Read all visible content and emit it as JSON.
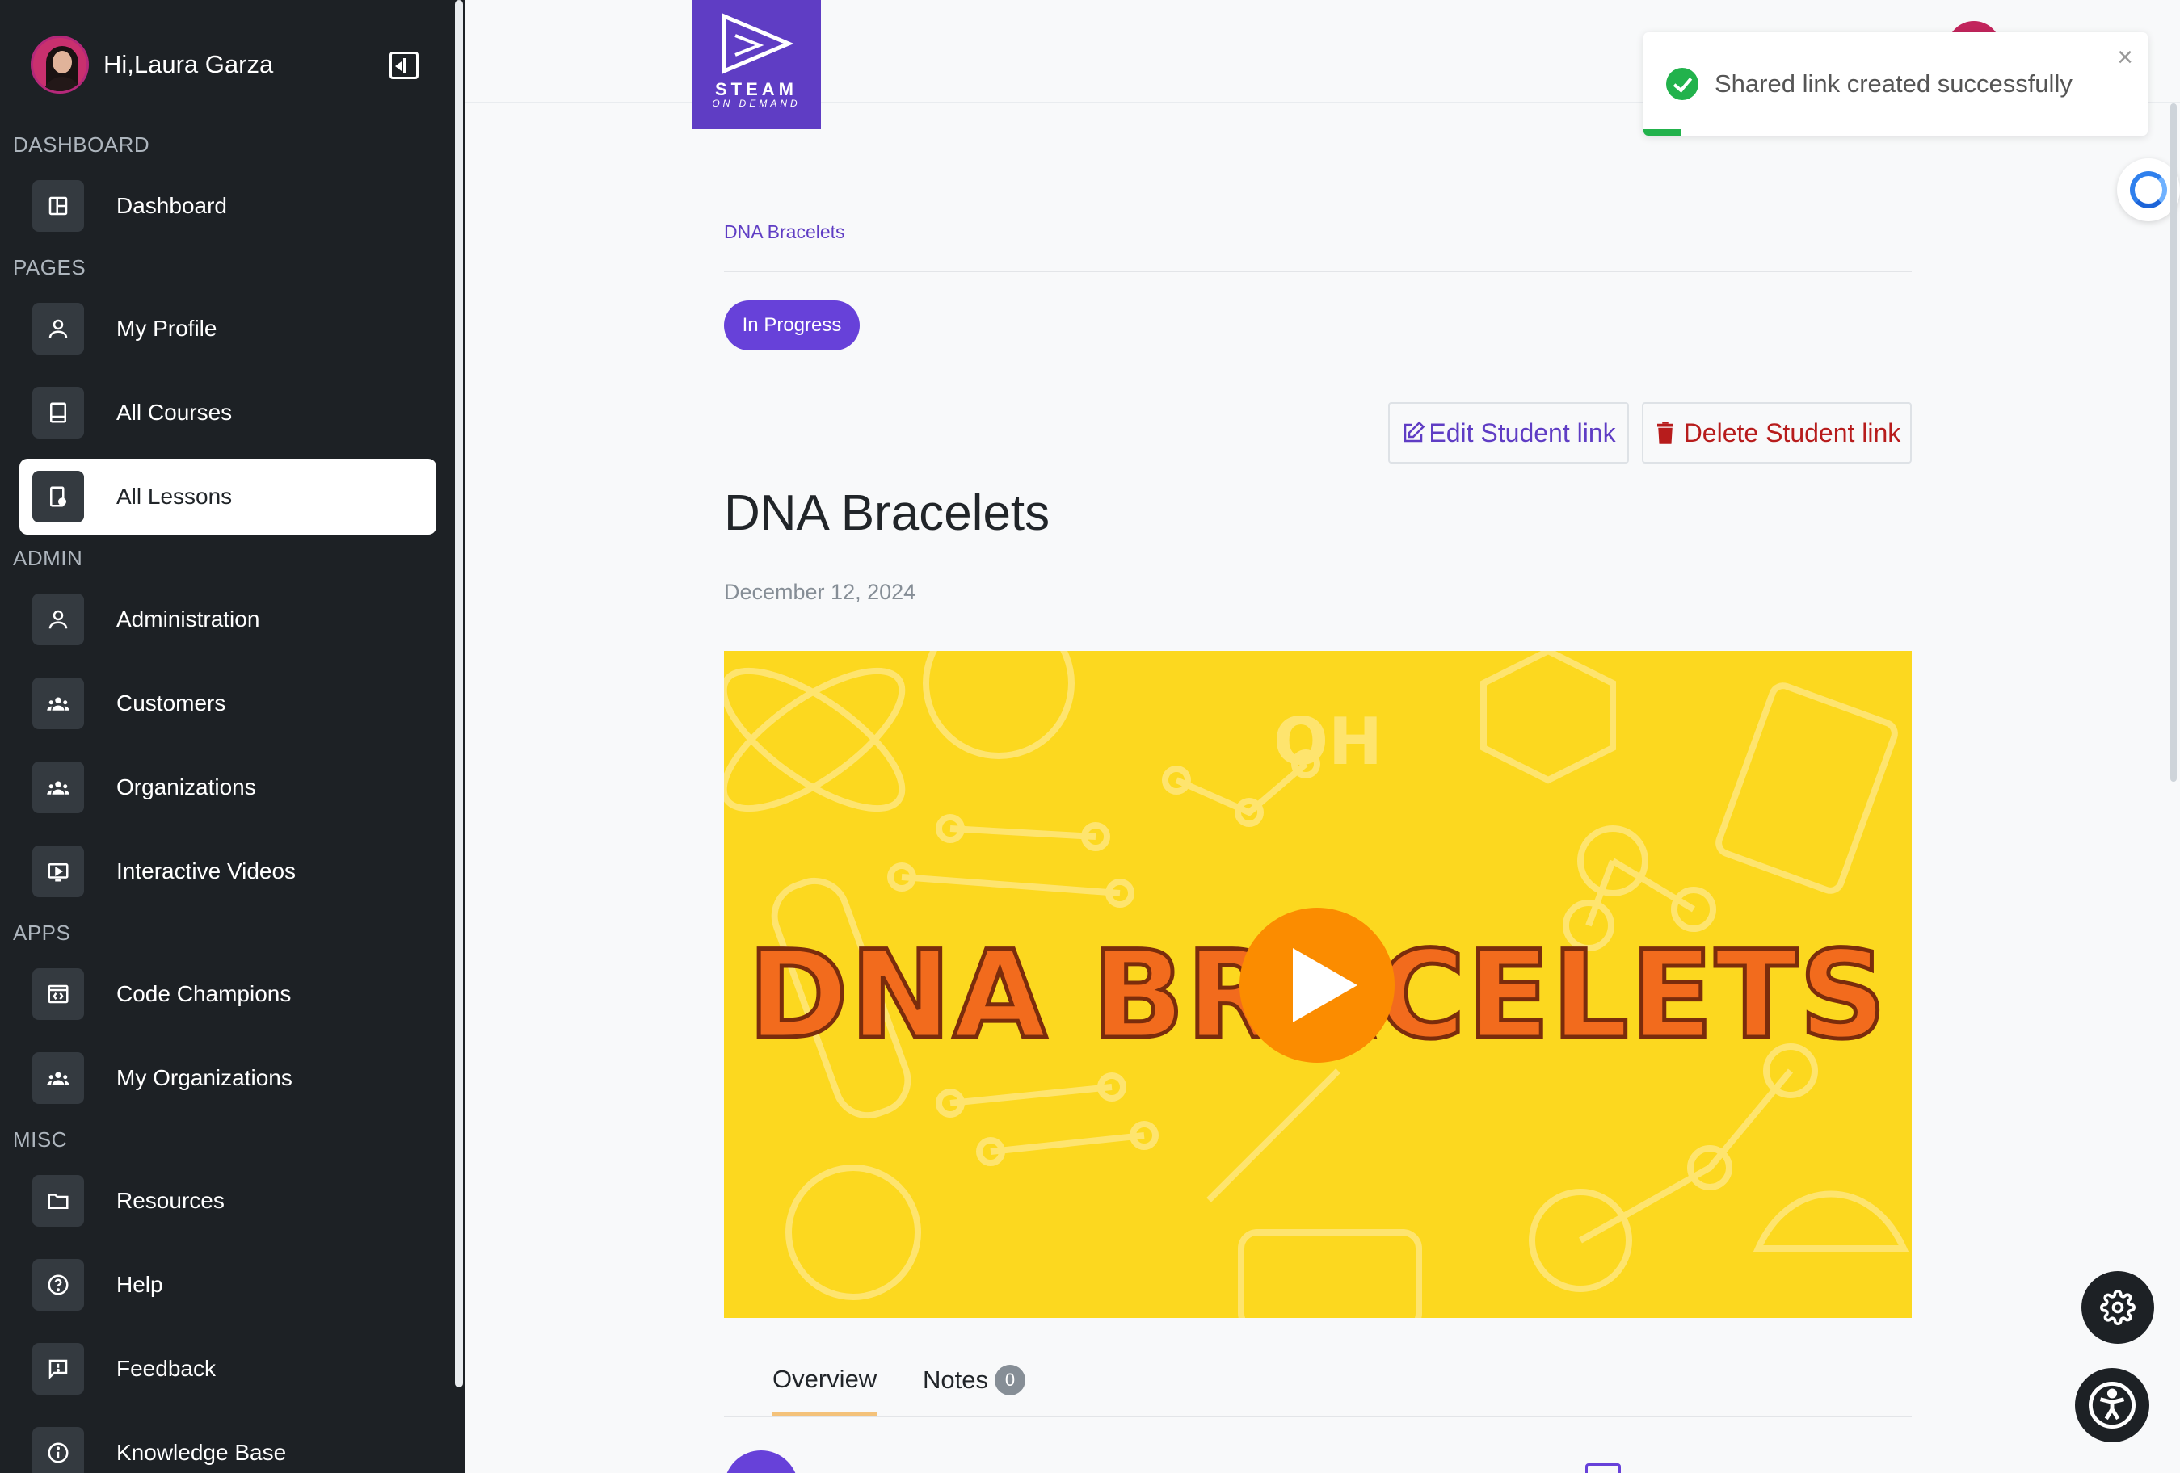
{
  "user": {
    "greeting": "Hi,Laura Garza"
  },
  "sidebar": {
    "sections": {
      "dashboard": "DASHBOARD",
      "pages": "PAGES",
      "admin": "ADMIN",
      "apps": "APPS",
      "misc": "MISC"
    },
    "items": {
      "dashboard": "Dashboard",
      "my_profile": "My Profile",
      "all_courses": "All Courses",
      "all_lessons": "All Lessons",
      "administration": "Administration",
      "customers": "Customers",
      "organizations": "Organizations",
      "interactive_videos": "Interactive Videos",
      "code_champions": "Code Champions",
      "my_organizations": "My Organizations",
      "resources": "Resources",
      "help": "Help",
      "feedback": "Feedback",
      "knowledge_base": "Knowledge Base"
    },
    "active_item": "All Lessons"
  },
  "logo": {
    "text": "STEAM",
    "sub": "ON DEMAND"
  },
  "toast": {
    "message": "Shared link created successfully",
    "close": "×",
    "color": "#22b24c"
  },
  "lesson": {
    "breadcrumb": "DNA Bracelets",
    "status": "In Progress",
    "title": "DNA Bracelets",
    "date": "December 12, 2024",
    "video_title": "DNA BRACELETS"
  },
  "actions": {
    "edit": "Edit Student link",
    "delete": "Delete Student link"
  },
  "tabs": {
    "overview": "Overview",
    "notes": "Notes",
    "notes_count": "0"
  },
  "colors": {
    "sidebar_bg": "#1d2125",
    "brand_purple": "#5f3dc4",
    "video_bg": "#fcd81f",
    "play_orange": "#fb8c00",
    "delete_red": "#b71c1c"
  },
  "icons": {
    "dashboard": "layout-icon",
    "my_profile": "user-icon",
    "all_courses": "book-icon",
    "all_lessons": "lesson-icon",
    "administration": "user-icon",
    "customers": "users-icon",
    "organizations": "users-icon",
    "interactive_videos": "video-icon",
    "code_champions": "code-icon",
    "my_organizations": "users-icon",
    "resources": "folder-icon",
    "help": "help-icon",
    "feedback": "feedback-icon",
    "knowledge_base": "info-icon"
  }
}
